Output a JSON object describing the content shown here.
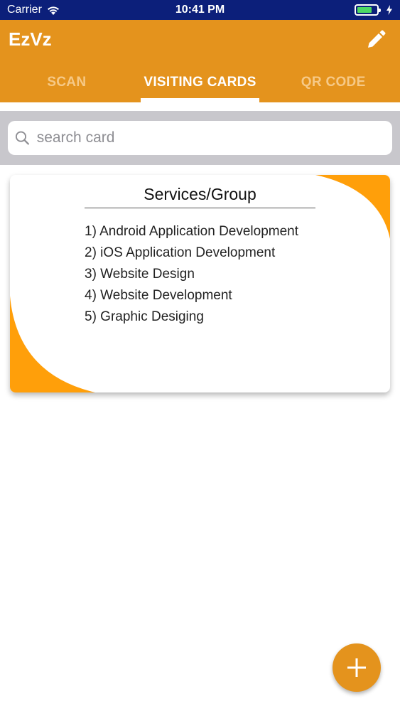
{
  "status_bar": {
    "carrier": "Carrier",
    "time": "10:41 PM",
    "battery_level": 0.75
  },
  "app": {
    "title": "EzVz",
    "edit_icon": "pencil-icon",
    "brand_color": "#e4931d"
  },
  "tabs": [
    {
      "label": "SCAN",
      "active": false
    },
    {
      "label": "VISITING CARDS",
      "active": true
    },
    {
      "label": "QR CODE",
      "active": false
    }
  ],
  "search": {
    "placeholder": "search card",
    "value": "",
    "icon": "search-icon"
  },
  "card": {
    "title": "Services/Group",
    "items": [
      "1) Android Application Development",
      "2) iOS Application Development",
      "3) Website Design",
      "4) Website Development",
      "5) Graphic Desiging"
    ],
    "accent_color": "#ff9f0a"
  },
  "fab": {
    "icon": "plus-icon"
  }
}
